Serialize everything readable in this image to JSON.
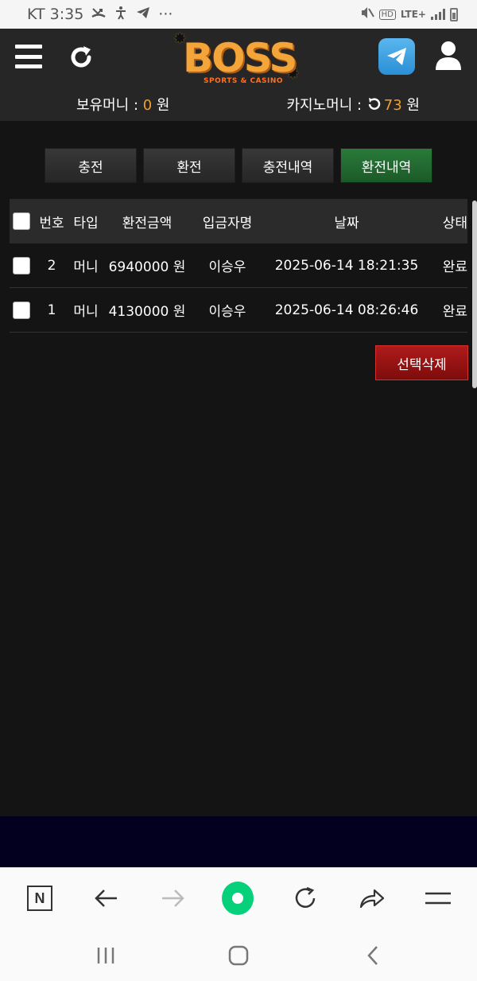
{
  "status_bar": {
    "time": "KT 3:35",
    "more": "···",
    "hd": "HD",
    "lte": "LTE+"
  },
  "header": {
    "logo_text": "BOSS",
    "logo_sub": "SPORTS & CASINO",
    "money_label": "보유머니 : ",
    "money_value": "0",
    "money_unit": " 원",
    "casino_label": "카지노머니 : ",
    "casino_value": "73",
    "casino_unit": " 원"
  },
  "tabs": [
    {
      "label": "충전",
      "active": false
    },
    {
      "label": "환전",
      "active": false
    },
    {
      "label": "충전내역",
      "active": false
    },
    {
      "label": "환전내역",
      "active": true
    }
  ],
  "table": {
    "headers": {
      "no": "번호",
      "type": "타입",
      "amount": "환전금액",
      "name": "입금자명",
      "date": "날짜",
      "status": "상태"
    },
    "rows": [
      {
        "no": "2",
        "type": "머니",
        "amount": "6940000 원",
        "name": "이승우",
        "date": "2025-06-14 18:21:35",
        "status": "완료"
      },
      {
        "no": "1",
        "type": "머니",
        "amount": "4130000 원",
        "name": "이승우",
        "date": "2025-06-14 08:26:46",
        "status": "완료"
      }
    ]
  },
  "delete_button": "선택삭제",
  "colors": {
    "accent_orange": "#f0a02a",
    "active_tab_green": "#1b5a28",
    "delete_red": "#9a1414",
    "browser_home_green": "#06d07a"
  }
}
